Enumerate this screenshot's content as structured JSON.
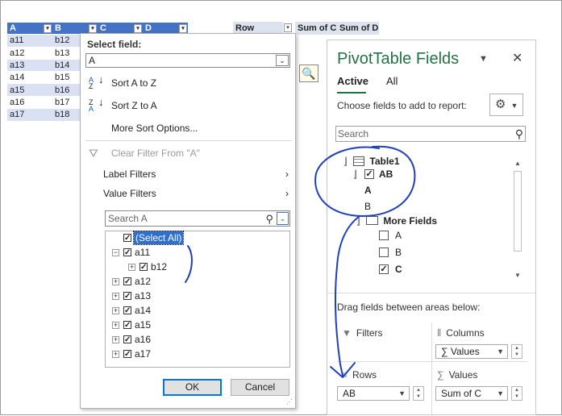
{
  "table": {
    "headers": [
      "A",
      "B",
      "C",
      "D"
    ],
    "rows": [
      [
        "a11",
        "b12",
        "",
        ""
      ],
      [
        "a12",
        "b13",
        "",
        ""
      ],
      [
        "a13",
        "b14",
        "",
        ""
      ],
      [
        "a14",
        "b15",
        "",
        ""
      ],
      [
        "a15",
        "b16",
        "",
        ""
      ],
      [
        "a16",
        "b17",
        "",
        ""
      ],
      [
        "a17",
        "b18",
        "",
        ""
      ]
    ]
  },
  "pivot_headers": [
    "Row Labels",
    "Sum of C",
    "Sum of D"
  ],
  "filter": {
    "select_field_label": "Select field:",
    "select_field_value": "A",
    "menu": {
      "sort_az": "Sort A to Z",
      "sort_za": "Sort Z to A",
      "more_sort": "More Sort Options...",
      "clear_filter": "Clear Filter From \"A\"",
      "label_filters": "Label Filters",
      "value_filters": "Value Filters"
    },
    "search_placeholder": "Search A",
    "tree": {
      "select_all": "(Select All)",
      "items": [
        "a11",
        "b12",
        "a12",
        "a13",
        "a14",
        "a15",
        "a16",
        "a17"
      ]
    },
    "ok": "OK",
    "cancel": "Cancel"
  },
  "pivot_pane": {
    "title": "PivotTable Fields",
    "tabs": {
      "active": "Active",
      "all": "All"
    },
    "choose_text": "Choose fields to add to report:",
    "search_placeholder": "Search",
    "fields": {
      "table1": "Table1",
      "ab": "AB",
      "a": "A",
      "b": "B",
      "more_fields": "More Fields",
      "sub_a": "A",
      "sub_b": "B",
      "sub_c": "C"
    },
    "drag_text": "Drag fields between areas below:",
    "areas": {
      "filters": "Filters",
      "columns": "Columns",
      "rows": "Rows",
      "values": "Values",
      "columns_value": "Values",
      "rows_value": "AB",
      "values_value": "Sum of C"
    }
  },
  "colors": {
    "table_header": "#4472c4",
    "table_band": "#d9e1f2",
    "pane_title": "#217346",
    "ink": "#1f3fbf"
  }
}
